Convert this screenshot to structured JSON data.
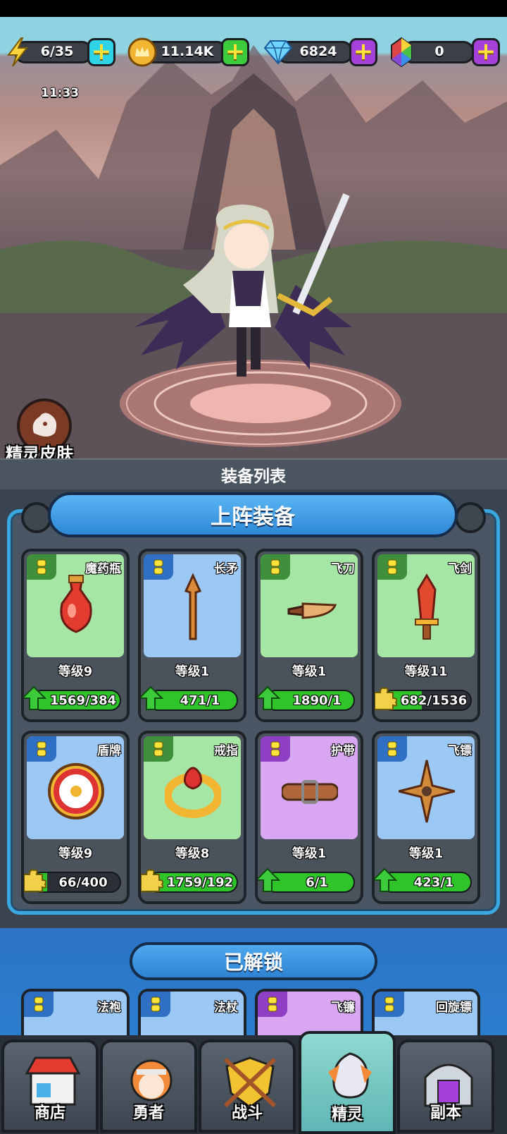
{
  "resources": {
    "energy": {
      "value": "6/35",
      "timer": "11:33",
      "icon": "lightning-icon"
    },
    "gold": {
      "value": "11.14K",
      "icon": "crown-coin-icon"
    },
    "diamond": {
      "value": "6824",
      "icon": "diamond-icon"
    },
    "gem": {
      "value": "0",
      "icon": "rainbow-gem-icon"
    }
  },
  "skin_button": {
    "label": "精灵皮肤"
  },
  "section_title": "装备列表",
  "equipped_banner": "上阵装备",
  "equipped": [
    {
      "name": "魔药瓶",
      "level": "等级9",
      "progress": "1569/384",
      "bg": "#a6e6a4",
      "tag": "#3f8f3c",
      "bar": "green",
      "fill": 1.0,
      "icon": "potion-bottle-icon"
    },
    {
      "name": "长矛",
      "level": "等级1",
      "progress": "471/1",
      "bg": "#9cc8f5",
      "tag": "#2f6fc4",
      "bar": "green",
      "fill": 1.0,
      "icon": "spear-icon"
    },
    {
      "name": "飞刀",
      "level": "等级1",
      "progress": "1890/1",
      "bg": "#a6e6a4",
      "tag": "#3f8f3c",
      "bar": "green",
      "fill": 1.0,
      "icon": "knife-icon"
    },
    {
      "name": "飞剑",
      "level": "等级11",
      "progress": "682/1536",
      "bg": "#a6e6a4",
      "tag": "#3f8f3c",
      "bar": "puzzle",
      "fill": 0.44,
      "icon": "flying-sword-icon"
    },
    {
      "name": "盾牌",
      "level": "等级9",
      "progress": "66/400",
      "bg": "#9cc8f5",
      "tag": "#2f6fc4",
      "bar": "puzzle",
      "fill": 0.17,
      "icon": "shield-icon"
    },
    {
      "name": "戒指",
      "level": "等级8",
      "progress": "1759/192",
      "bg": "#a6e6a4",
      "tag": "#3f8f3c",
      "bar": "puzzle",
      "fill": 1.0,
      "icon": "ring-icon"
    },
    {
      "name": "护带",
      "level": "等级1",
      "progress": "6/1",
      "bg": "#d9a6f2",
      "tag": "#8e3fc4",
      "bar": "green",
      "fill": 1.0,
      "icon": "belt-icon"
    },
    {
      "name": "飞镖",
      "level": "等级1",
      "progress": "423/1",
      "bg": "#9cc8f5",
      "tag": "#2f6fc4",
      "bar": "green",
      "fill": 1.0,
      "icon": "shuriken-icon"
    }
  ],
  "unlocked_banner": "已解锁",
  "unlocked": [
    {
      "name": "法袍",
      "bg": "#9cc8f5",
      "tag": "#2f6fc4"
    },
    {
      "name": "法杖",
      "bg": "#9cc8f5",
      "tag": "#2f6fc4"
    },
    {
      "name": "飞镰",
      "bg": "#d9a6f2",
      "tag": "#8e3fc4"
    },
    {
      "name": "回旋镖",
      "bg": "#9cc8f5",
      "tag": "#2f6fc4"
    }
  ],
  "nav": [
    {
      "label": "商店",
      "icon": "shop-icon"
    },
    {
      "label": "勇者",
      "icon": "hero-icon"
    },
    {
      "label": "战斗",
      "icon": "battle-shield-icon"
    },
    {
      "label": "精灵",
      "icon": "spirit-icon",
      "active": true
    },
    {
      "label": "副本",
      "icon": "dungeon-gate-icon"
    }
  ]
}
